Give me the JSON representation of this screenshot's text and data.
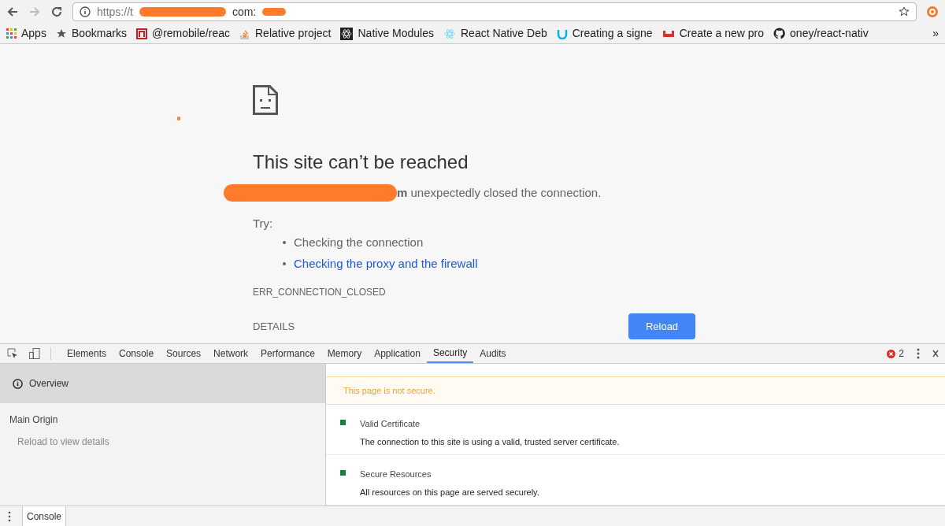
{
  "toolbar": {
    "url_start": "https://t",
    "url_end": "com:"
  },
  "bookmarks": [
    {
      "label": "Apps",
      "kind": "apps"
    },
    {
      "label": "Bookmarks",
      "kind": "star"
    },
    {
      "label": "@remobile/reac",
      "kind": "npm"
    },
    {
      "label": "Relative project",
      "kind": "stack"
    },
    {
      "label": "Native Modules",
      "kind": "react-dark"
    },
    {
      "label": "React Native Deb",
      "kind": "react-light"
    },
    {
      "label": "Creating a signe",
      "kind": "udacity"
    },
    {
      "label": "Create a new pro",
      "kind": "tray"
    },
    {
      "label": "oney/react-nativ",
      "kind": "github"
    }
  ],
  "bookmarks_more": "»",
  "error_page": {
    "title": "This site can’t be reached",
    "message": "**m** unexpectedly closed the connection.",
    "try_label": "Try:",
    "suggestions": [
      {
        "text": "Checking the connection",
        "link": false
      },
      {
        "text": "Checking the proxy and the firewall",
        "link": true
      }
    ],
    "code": "ERR_CONNECTION_CLOSED",
    "details": "DETAILS",
    "reload": "Reload"
  },
  "devtools": {
    "tabs": [
      {
        "label": "Elements",
        "selected": false
      },
      {
        "label": "Console",
        "selected": false
      },
      {
        "label": "Sources",
        "selected": false
      },
      {
        "label": "Network",
        "selected": false
      },
      {
        "label": "Performance",
        "selected": false
      },
      {
        "label": "Memory",
        "selected": false
      },
      {
        "label": "Application",
        "selected": false
      },
      {
        "label": "Security",
        "selected": true
      },
      {
        "label": "Audits",
        "selected": false
      }
    ],
    "error_count": "2",
    "sidebar": {
      "overview": {
        "label": "Overview",
        "selected": true
      },
      "section": "Main Origin",
      "hint": "Reload to view details"
    },
    "banner": "This page is not secure.",
    "items": [
      {
        "title": "Valid Certificate",
        "description": "The connection to this site is using a valid, trusted server certificate.",
        "color": "#188038"
      },
      {
        "title": "Secure Resources",
        "description": "All resources on this page are served securely.",
        "color": "#188038"
      }
    ],
    "drawer_tab": "Console"
  }
}
